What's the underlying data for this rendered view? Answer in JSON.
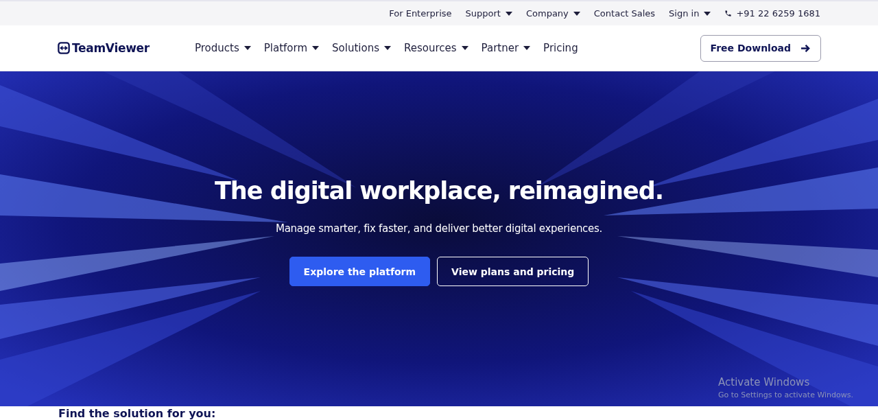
{
  "utility_nav": {
    "items": [
      {
        "label": "For Enterprise",
        "has_menu": false
      },
      {
        "label": "Support",
        "has_menu": true
      },
      {
        "label": "Company",
        "has_menu": true
      },
      {
        "label": "Contact Sales",
        "has_menu": false
      },
      {
        "label": "Sign in",
        "has_menu": true
      }
    ],
    "phone": "+91 22 6259 1681"
  },
  "header": {
    "logo": "TeamViewer",
    "nav": [
      {
        "label": "Products",
        "has_menu": true
      },
      {
        "label": "Platform",
        "has_menu": true
      },
      {
        "label": "Solutions",
        "has_menu": true
      },
      {
        "label": "Resources",
        "has_menu": true
      },
      {
        "label": "Partner",
        "has_menu": true
      },
      {
        "label": "Pricing",
        "has_menu": false
      }
    ],
    "cta": "Free Download"
  },
  "hero": {
    "title": "The digital workplace, reimagined.",
    "subtitle": "Manage smarter, fix faster, and deliver better digital experiences.",
    "buttons": [
      {
        "label": "Explore the platform",
        "kind": "primary"
      },
      {
        "label": "View plans and pricing",
        "kind": "outline"
      }
    ]
  },
  "activation_notice": {
    "title": "Activate Windows",
    "message": "Go to Settings to activate Windows."
  },
  "section": {
    "heading": "Find the solution for you:"
  }
}
